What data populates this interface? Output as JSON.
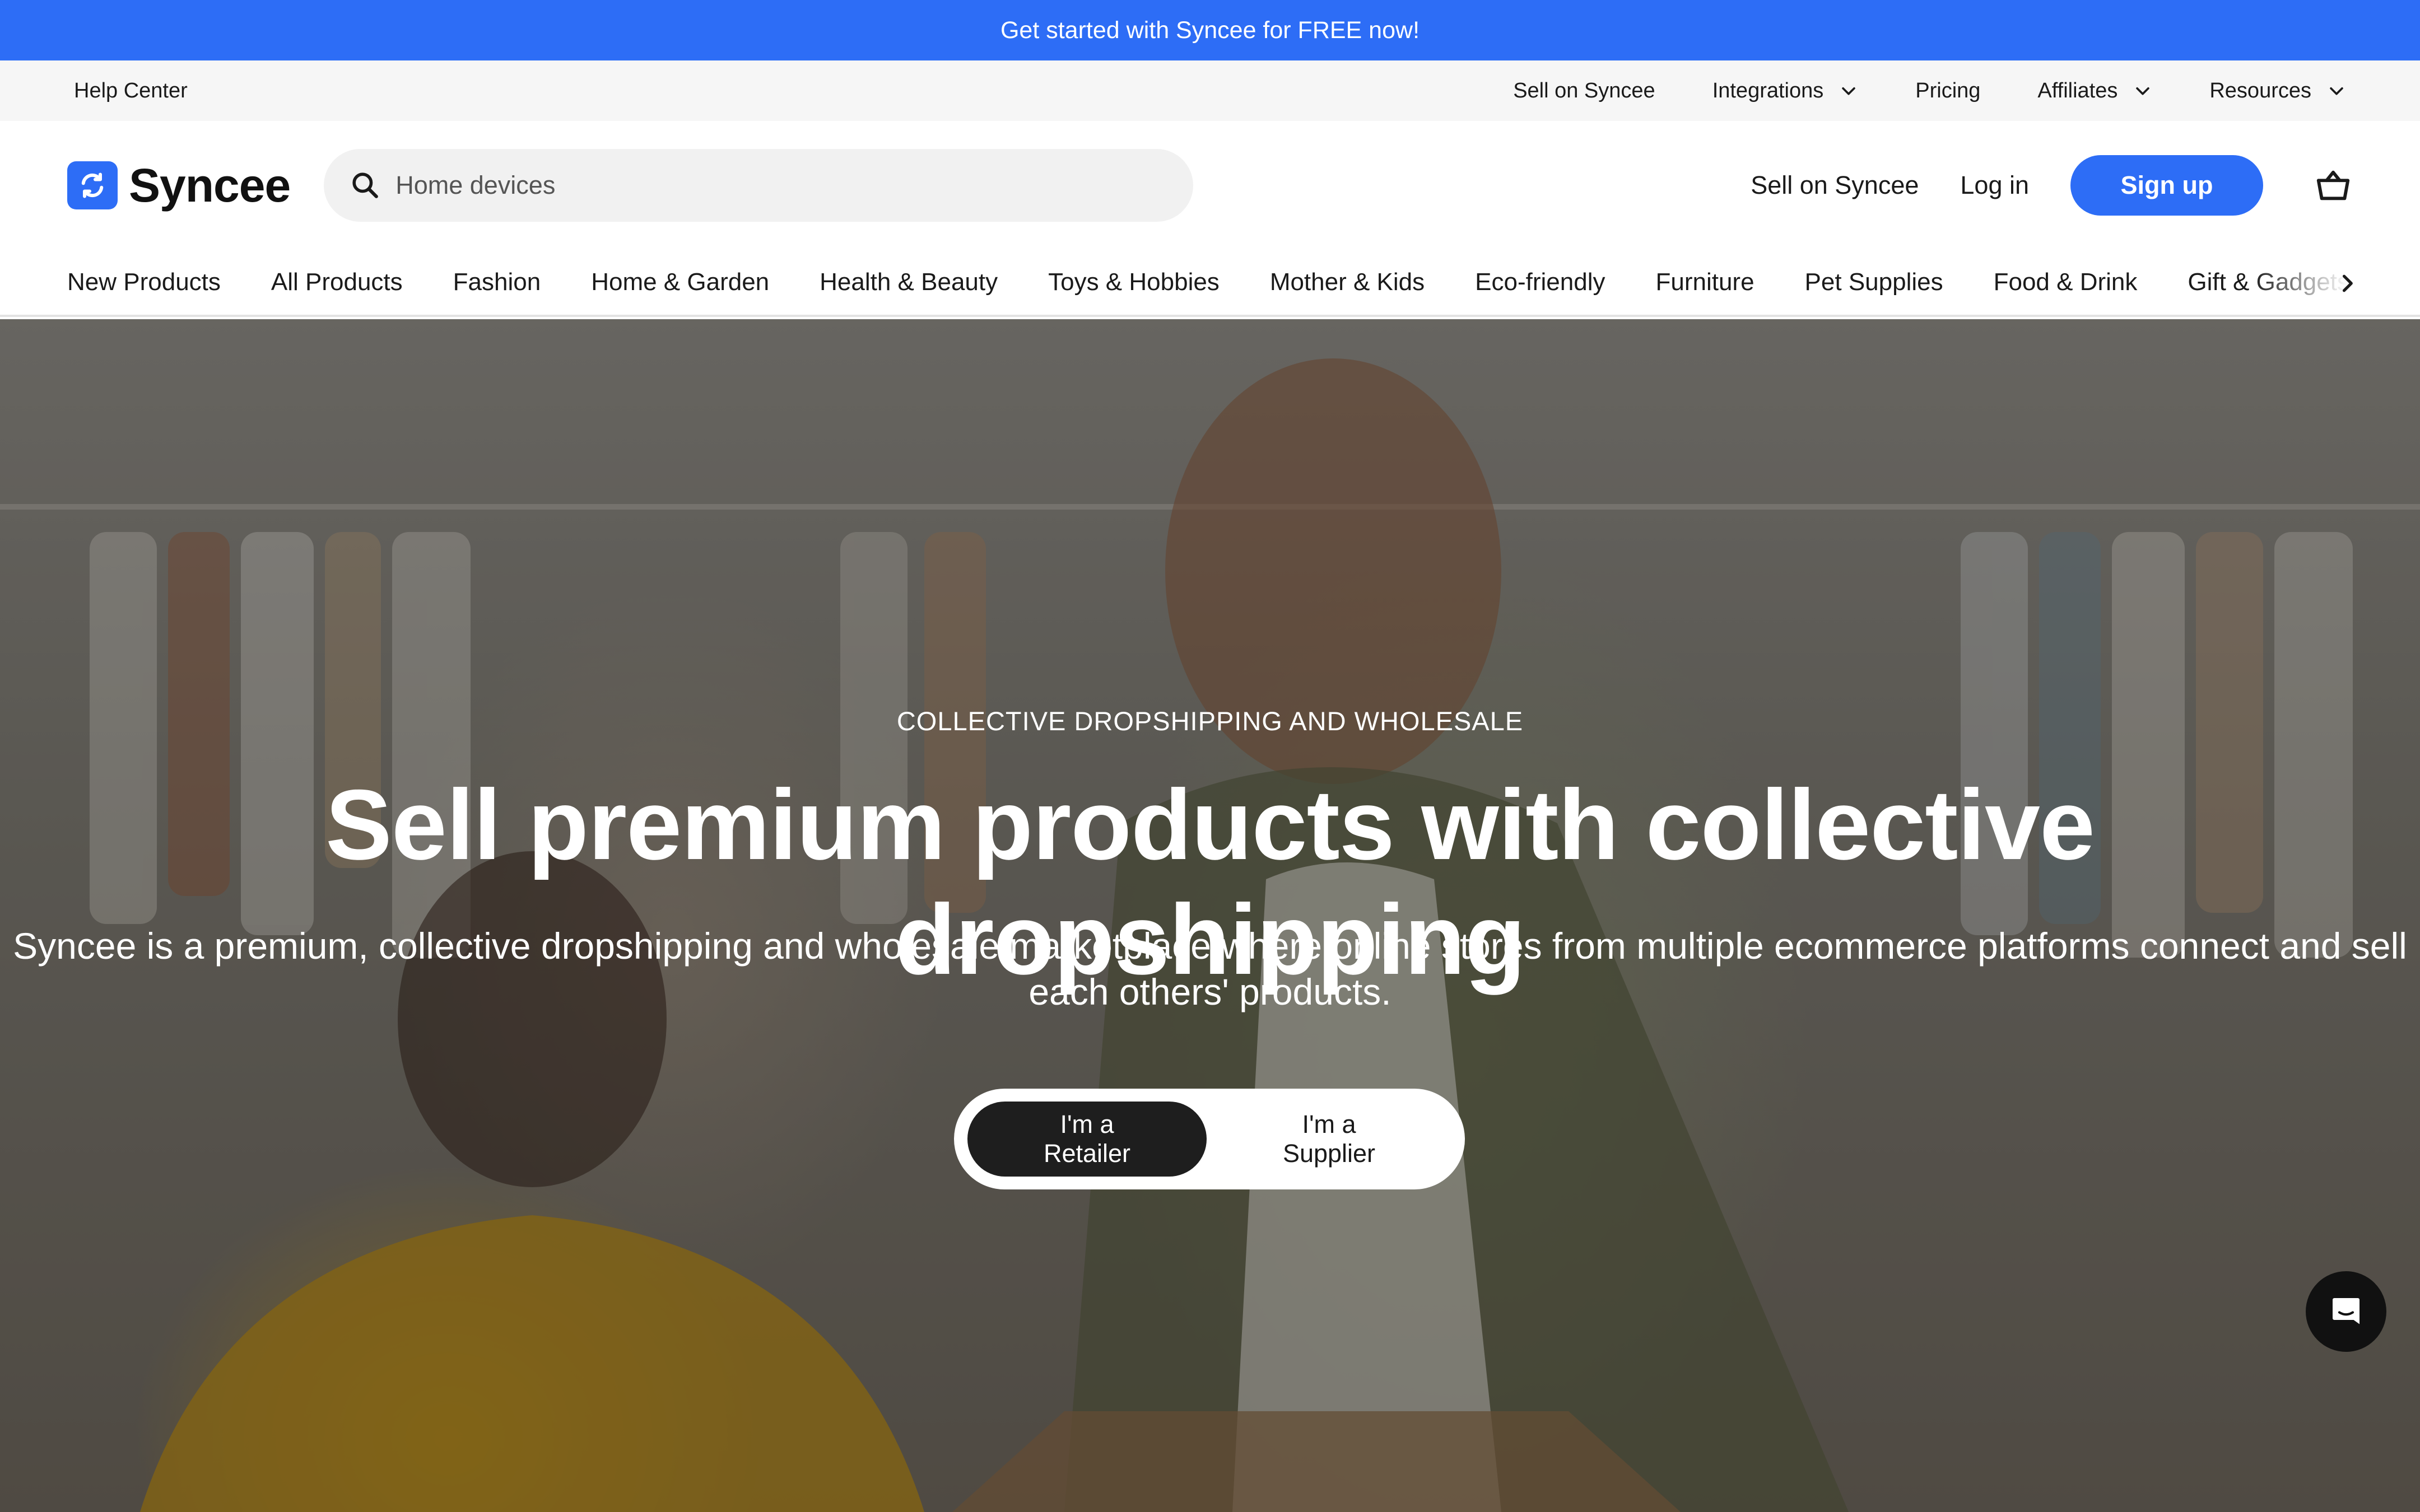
{
  "promo": {
    "text": "Get started with Syncee for FREE now!"
  },
  "utility": {
    "help": "Help Center",
    "items": [
      {
        "label": "Sell on Syncee",
        "dropdown": false
      },
      {
        "label": "Integrations",
        "dropdown": true
      },
      {
        "label": "Pricing",
        "dropdown": false
      },
      {
        "label": "Affiliates",
        "dropdown": true
      },
      {
        "label": "Resources",
        "dropdown": true
      }
    ]
  },
  "header": {
    "logo_text": "Syncee",
    "search_placeholder": "Home devices",
    "sell_link": "Sell on Syncee",
    "login": "Log in",
    "signup": "Sign up"
  },
  "categories": [
    "New Products",
    "All Products",
    "Fashion",
    "Home & Garden",
    "Health & Beauty",
    "Toys & Hobbies",
    "Mother & Kids",
    "Eco-friendly",
    "Furniture",
    "Pet Supplies",
    "Food & Drink",
    "Gift & Gadgets"
  ],
  "hero": {
    "eyebrow": "COLLECTIVE DROPSHIPPING AND WHOLESALE",
    "headline": "Sell premium products with collective dropshipping",
    "subline": "Syncee is a premium, collective dropshipping and wholesale marketplace where online stores from multiple ecommerce platforms connect and sell each others' products.",
    "retailer": "I'm a Retailer",
    "supplier": "I'm a Supplier"
  },
  "colors": {
    "brand": "#2d6df6",
    "dark": "#1e1e1e"
  }
}
